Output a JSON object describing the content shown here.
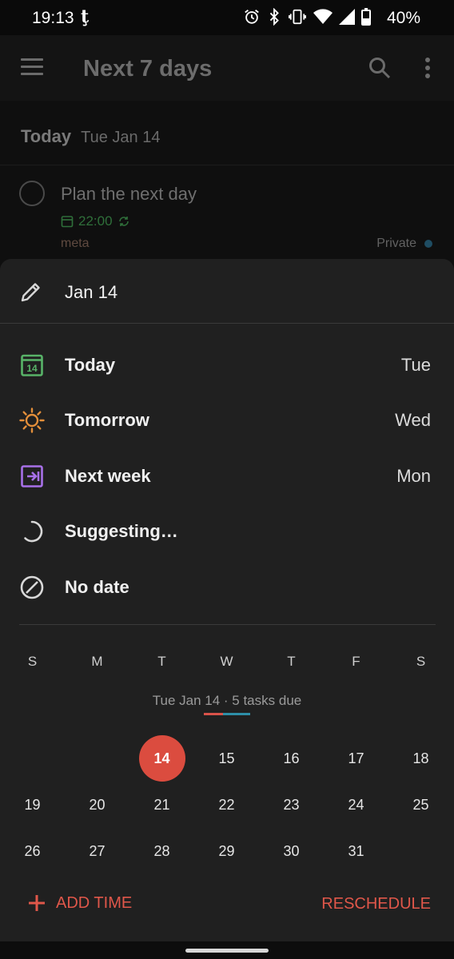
{
  "status_bar": {
    "time": "19:13",
    "app_glyph": "ţ",
    "battery": "40%",
    "icons": [
      "alarm-icon",
      "bluetooth-icon",
      "vibrate-icon",
      "wifi-icon",
      "signal-icon",
      "battery-icon"
    ]
  },
  "app_bar": {
    "title": "Next 7 days"
  },
  "background_list": {
    "section_label": "Today",
    "section_date": "Tue Jan 14",
    "task": {
      "title": "Plan the next day",
      "due_time": "22:00",
      "label": "meta",
      "project": "Private"
    }
  },
  "sheet": {
    "date_input": "Jan 14",
    "options": [
      {
        "label": "Today",
        "day": "Tue",
        "icon": "calendar-today-icon",
        "color": "#58b368"
      },
      {
        "label": "Tomorrow",
        "day": "Wed",
        "icon": "sun-icon",
        "color": "#e48f3a"
      },
      {
        "label": "Next week",
        "day": "Mon",
        "icon": "next-week-icon",
        "color": "#a770e8"
      },
      {
        "label": "Suggesting…",
        "day": "",
        "icon": "spinner-icon",
        "color": "#d8d8d8"
      },
      {
        "label": "No date",
        "day": "",
        "icon": "no-date-icon",
        "color": "#d8d8d8"
      }
    ],
    "weekdays": [
      "S",
      "M",
      "T",
      "W",
      "T",
      "F",
      "S"
    ],
    "month_info": "Tue Jan 14 · 5 tasks due",
    "calendar_days": [
      "",
      "",
      "14",
      "15",
      "16",
      "17",
      "18",
      "19",
      "20",
      "21",
      "22",
      "23",
      "24",
      "25",
      "26",
      "27",
      "28",
      "29",
      "30",
      "31",
      ""
    ],
    "selected_day": "14",
    "add_time_label": "ADD TIME",
    "reschedule_label": "RESCHEDULE"
  },
  "colors": {
    "accent": "#db4c3f",
    "sheet_bg": "#202020"
  }
}
